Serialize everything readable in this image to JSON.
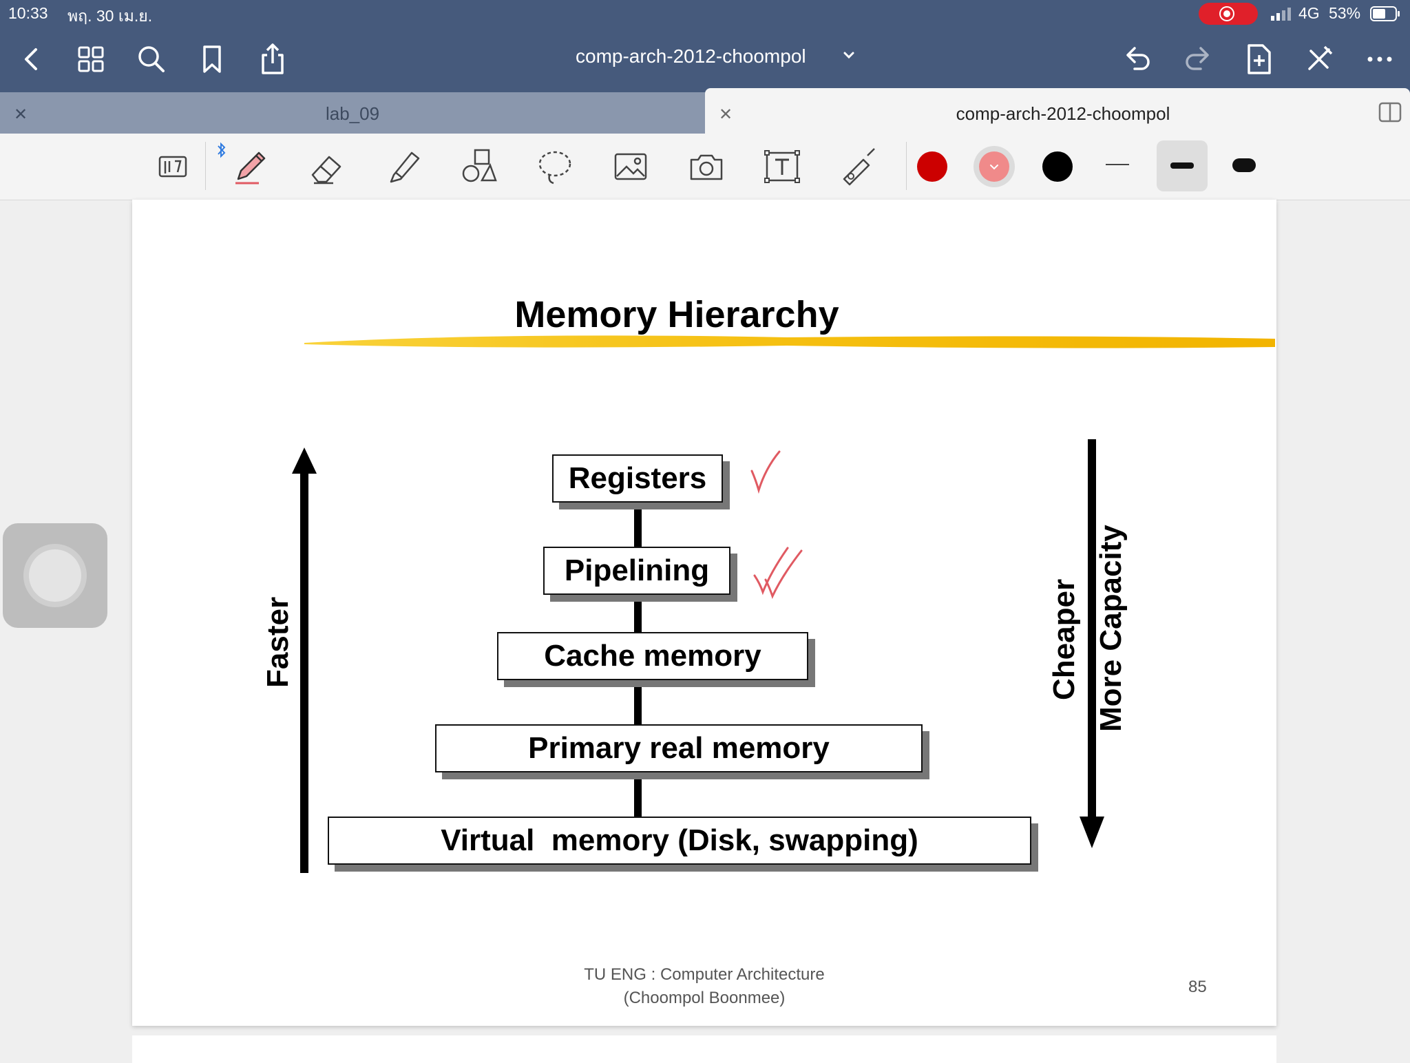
{
  "status_bar": {
    "time": "10:33",
    "date": "พฤ. 30 เม.ย.",
    "network": "4G",
    "battery": "53%"
  },
  "nav_bar": {
    "document_title": "comp-arch-2012-choompol",
    "icons": [
      "back-icon",
      "grid-icon",
      "search-icon",
      "bookmark-icon",
      "share-icon",
      "undo-icon",
      "redo-icon",
      "add-page-icon",
      "close-pen-icon",
      "more-icon"
    ]
  },
  "tabs": [
    {
      "label": "lab_09",
      "active": false
    },
    {
      "label": "comp-arch-2012-choompol",
      "active": true
    }
  ],
  "toolbar": {
    "tools": [
      "read-mode-icon",
      "pen-icon",
      "eraser-icon",
      "highlighter-icon",
      "shapes-icon",
      "lasso-icon",
      "image-icon",
      "camera-icon",
      "text-icon",
      "laser-pointer-icon"
    ],
    "active_tool": "pen-icon",
    "colors": [
      "#cc0000",
      "#f08a8a",
      "#000000"
    ],
    "selected_color": "#f08a8a",
    "stroke_widths": [
      "thin",
      "medium",
      "thick"
    ],
    "selected_stroke": "medium"
  },
  "slide": {
    "title": "Memory Hierarchy",
    "levels": [
      "Registers",
      "Pipelining",
      "Cache memory",
      "Primary real memory",
      "Virtual  memory (Disk, swapping)"
    ],
    "left_axis_label": "Faster",
    "right_axis_labels": [
      "Cheaper",
      "More Capacity"
    ],
    "checkmarks": [
      {
        "level": "Registers",
        "count": 1
      },
      {
        "level": "Pipelining",
        "count": 2
      }
    ],
    "footer_line1": "TU ENG : Computer Architecture",
    "footer_line2": "(Choompol Boonmee)",
    "page_number": "85"
  },
  "colors": {
    "nav_background": "#465a7c",
    "highlight_yellow": "#f7c21a",
    "annotation_red": "#e05a62"
  }
}
